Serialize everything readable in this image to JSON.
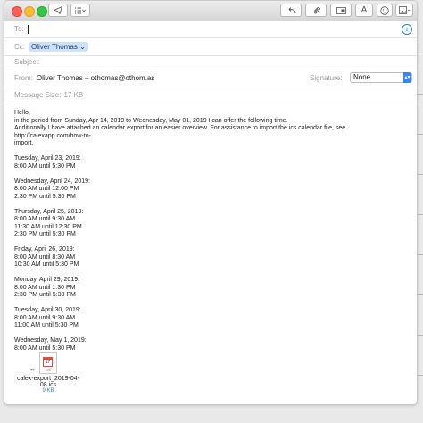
{
  "header": {
    "to_label": "To:",
    "cc_label": "Cc:",
    "cc_recipient": "Oliver Thomas",
    "subject_label": "Subject:",
    "from_label": "From:",
    "from_value": "Oliver Thomas – othomas@othom.as",
    "signature_label": "Signature:",
    "signature_value": "None",
    "size_label": "Message Size:",
    "size_value": "17 KB"
  },
  "toolbar": {
    "send_icon": "paper-plane-icon",
    "format_icon": "list-icon",
    "reply_icon": "undo-arrow-icon",
    "attach_icon": "paperclip-icon",
    "header_icon": "header-fields-icon",
    "font_label": "A",
    "emoji_icon": "smiley-icon",
    "photo_icon": "photo-browser-icon"
  },
  "body": {
    "greeting": "Hello,",
    "line1": "in the period from Sunday, Apr 14, 2019 to Wednesday, May 01, 2019 I can offer the following time.",
    "line2": "Additionally I have attached an calendar export for an easier overview. For assistance to import the ics calendar file, see http://calexapp.com/how-to-",
    "line3": "import.",
    "days": [
      {
        "day": "Tuesday, April 23, 2019:",
        "slots": [
          "8:00 AM until 5:30 PM"
        ]
      },
      {
        "day": "Wednesday, April 24, 2019:",
        "slots": [
          "8:00 AM until 12:00 PM",
          "2:30 PM until 5:30 PM"
        ]
      },
      {
        "day": "Thursday, April 25, 2019:",
        "slots": [
          "8:00 AM until 9:30 AM",
          "11:30 AM until 12:30 PM",
          "2:30 PM until 5:30 PM"
        ]
      },
      {
        "day": "Friday, April 26, 2019:",
        "slots": [
          "8:00 AM until 8:30 AM",
          "10:30 AM until 5:30 PM"
        ]
      },
      {
        "day": "Monday, April 29, 2019:",
        "slots": [
          "8:00 AM until 1:30 PM",
          "2:30 PM until 5:30 PM"
        ]
      },
      {
        "day": "Tuesday, April 30, 2019:",
        "slots": [
          "8:00 AM until 9:30 AM",
          "11:00 AM until 5:30 PM"
        ]
      },
      {
        "day": "Wednesday, May 1, 2019:",
        "slots": [
          "8:00 AM until 5:30 PM"
        ]
      }
    ],
    "signature_sep": "--"
  },
  "attachment": {
    "name_line1": "calex-export_2019-04-",
    "name_line2": "08.ics",
    "size": "9 KB",
    "icon_date": "17",
    "icon_ext": "ICS"
  }
}
